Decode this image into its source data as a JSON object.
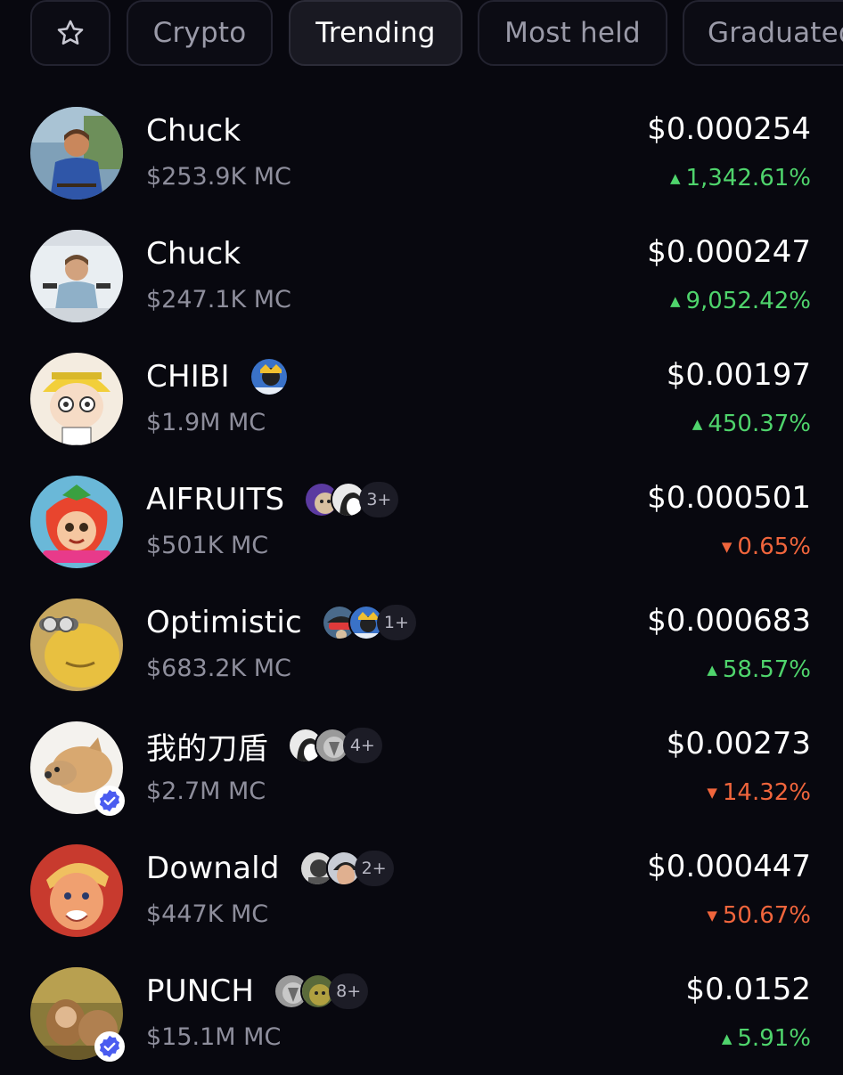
{
  "tabs": [
    {
      "icon": "star-icon",
      "label": ""
    },
    {
      "label": "Crypto"
    },
    {
      "label": "Trending",
      "active": true
    },
    {
      "label": "Most held"
    },
    {
      "label": "Graduated"
    }
  ],
  "colors": {
    "background": "#08080f",
    "positive": "#4fd46c",
    "negative": "#f0653c",
    "verified": "#4a5cf0"
  },
  "tokens": [
    {
      "name": "Chuck",
      "market_cap": "$253.9K MC",
      "price": "$0.000254",
      "change": "1,342.61%",
      "direction": "up",
      "holders_extra": "",
      "verified": false
    },
    {
      "name": "Chuck",
      "market_cap": "$247.1K MC",
      "price": "$0.000247",
      "change": "9,052.42%",
      "direction": "up",
      "holders_extra": "",
      "verified": false
    },
    {
      "name": "CHIBI",
      "market_cap": "$1.9M MC",
      "price": "$0.00197",
      "change": "450.37%",
      "direction": "up",
      "holders_extra": "",
      "verified": false
    },
    {
      "name": "AIFRUITS",
      "market_cap": "$501K MC",
      "price": "$0.000501",
      "change": "0.65%",
      "direction": "down",
      "holders_extra": "3+",
      "verified": false
    },
    {
      "name": "Optimistic",
      "market_cap": "$683.2K MC",
      "price": "$0.000683",
      "change": "58.57%",
      "direction": "up",
      "holders_extra": "1+",
      "verified": false
    },
    {
      "name": "我的刀盾",
      "market_cap": "$2.7M MC",
      "price": "$0.00273",
      "change": "14.32%",
      "direction": "down",
      "holders_extra": "4+",
      "verified": true
    },
    {
      "name": "Downald",
      "market_cap": "$447K MC",
      "price": "$0.000447",
      "change": "50.67%",
      "direction": "down",
      "holders_extra": "2+",
      "verified": false
    },
    {
      "name": "PUNCH",
      "market_cap": "$15.1M MC",
      "price": "$0.0152",
      "change": "5.91%",
      "direction": "up",
      "holders_extra": "8+",
      "verified": true
    }
  ]
}
